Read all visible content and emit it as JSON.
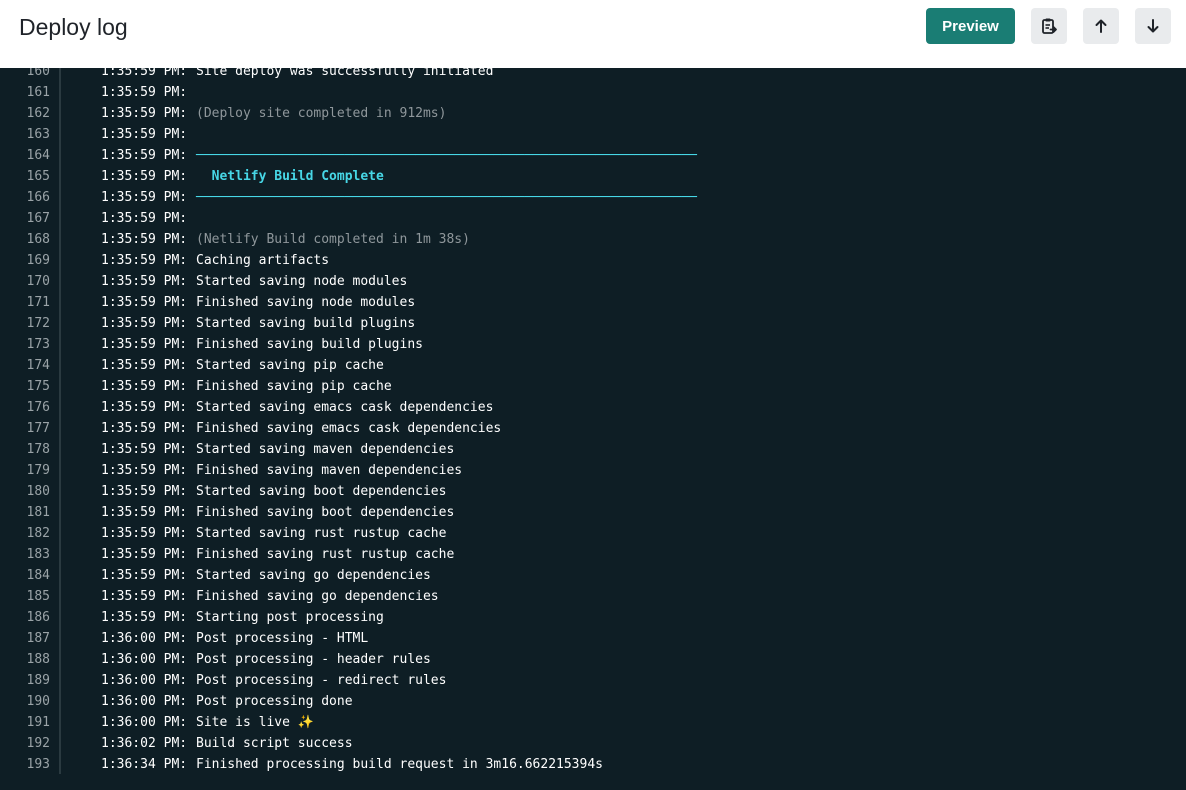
{
  "header": {
    "title": "Deploy log",
    "preview_label": "Preview",
    "copy_icon": "clipboard-copy-icon",
    "up_icon": "arrow-up-icon",
    "down_icon": "arrow-down-icon",
    "accent_color": "#1a7d74"
  },
  "log": {
    "background": "#0e1e25",
    "highlight_color": "#47d7e6",
    "lines": [
      {
        "num": "160",
        "ts": "1:35:59 PM:",
        "msg": "Site deploy was successfully initiated",
        "style": "normal"
      },
      {
        "num": "161",
        "ts": "1:35:59 PM:",
        "msg": "",
        "style": "normal"
      },
      {
        "num": "162",
        "ts": "1:35:59 PM:",
        "msg": "(Deploy site completed in 912ms)",
        "style": "muted"
      },
      {
        "num": "163",
        "ts": "1:35:59 PM:",
        "msg": "",
        "style": "normal"
      },
      {
        "num": "164",
        "ts": "1:35:59 PM:",
        "msg": "────────────────────────────────────────────────────────────────",
        "style": "rule"
      },
      {
        "num": "165",
        "ts": "1:35:59 PM:",
        "msg": "  Netlify Build Complete",
        "style": "accent"
      },
      {
        "num": "166",
        "ts": "1:35:59 PM:",
        "msg": "────────────────────────────────────────────────────────────────",
        "style": "rule"
      },
      {
        "num": "167",
        "ts": "1:35:59 PM:",
        "msg": "",
        "style": "normal"
      },
      {
        "num": "168",
        "ts": "1:35:59 PM:",
        "msg": "(Netlify Build completed in 1m 38s)",
        "style": "muted"
      },
      {
        "num": "169",
        "ts": "1:35:59 PM:",
        "msg": "Caching artifacts",
        "style": "normal"
      },
      {
        "num": "170",
        "ts": "1:35:59 PM:",
        "msg": "Started saving node modules",
        "style": "normal"
      },
      {
        "num": "171",
        "ts": "1:35:59 PM:",
        "msg": "Finished saving node modules",
        "style": "normal"
      },
      {
        "num": "172",
        "ts": "1:35:59 PM:",
        "msg": "Started saving build plugins",
        "style": "normal"
      },
      {
        "num": "173",
        "ts": "1:35:59 PM:",
        "msg": "Finished saving build plugins",
        "style": "normal"
      },
      {
        "num": "174",
        "ts": "1:35:59 PM:",
        "msg": "Started saving pip cache",
        "style": "normal"
      },
      {
        "num": "175",
        "ts": "1:35:59 PM:",
        "msg": "Finished saving pip cache",
        "style": "normal"
      },
      {
        "num": "176",
        "ts": "1:35:59 PM:",
        "msg": "Started saving emacs cask dependencies",
        "style": "normal"
      },
      {
        "num": "177",
        "ts": "1:35:59 PM:",
        "msg": "Finished saving emacs cask dependencies",
        "style": "normal"
      },
      {
        "num": "178",
        "ts": "1:35:59 PM:",
        "msg": "Started saving maven dependencies",
        "style": "normal"
      },
      {
        "num": "179",
        "ts": "1:35:59 PM:",
        "msg": "Finished saving maven dependencies",
        "style": "normal"
      },
      {
        "num": "180",
        "ts": "1:35:59 PM:",
        "msg": "Started saving boot dependencies",
        "style": "normal"
      },
      {
        "num": "181",
        "ts": "1:35:59 PM:",
        "msg": "Finished saving boot dependencies",
        "style": "normal"
      },
      {
        "num": "182",
        "ts": "1:35:59 PM:",
        "msg": "Started saving rust rustup cache",
        "style": "normal"
      },
      {
        "num": "183",
        "ts": "1:35:59 PM:",
        "msg": "Finished saving rust rustup cache",
        "style": "normal"
      },
      {
        "num": "184",
        "ts": "1:35:59 PM:",
        "msg": "Started saving go dependencies",
        "style": "normal"
      },
      {
        "num": "185",
        "ts": "1:35:59 PM:",
        "msg": "Finished saving go dependencies",
        "style": "normal"
      },
      {
        "num": "186",
        "ts": "1:35:59 PM:",
        "msg": "Starting post processing",
        "style": "normal"
      },
      {
        "num": "187",
        "ts": "1:36:00 PM:",
        "msg": "Post processing - HTML",
        "style": "normal"
      },
      {
        "num": "188",
        "ts": "1:36:00 PM:",
        "msg": "Post processing - header rules",
        "style": "normal"
      },
      {
        "num": "189",
        "ts": "1:36:00 PM:",
        "msg": "Post processing - redirect rules",
        "style": "normal"
      },
      {
        "num": "190",
        "ts": "1:36:00 PM:",
        "msg": "Post processing done",
        "style": "normal"
      },
      {
        "num": "191",
        "ts": "1:36:00 PM:",
        "msg": "Site is live",
        "style": "normal",
        "emoji": "✨"
      },
      {
        "num": "192",
        "ts": "1:36:02 PM:",
        "msg": "Build script success",
        "style": "normal"
      },
      {
        "num": "193",
        "ts": "1:36:34 PM:",
        "msg": "Finished processing build request in 3m16.662215394s",
        "style": "normal"
      }
    ]
  }
}
